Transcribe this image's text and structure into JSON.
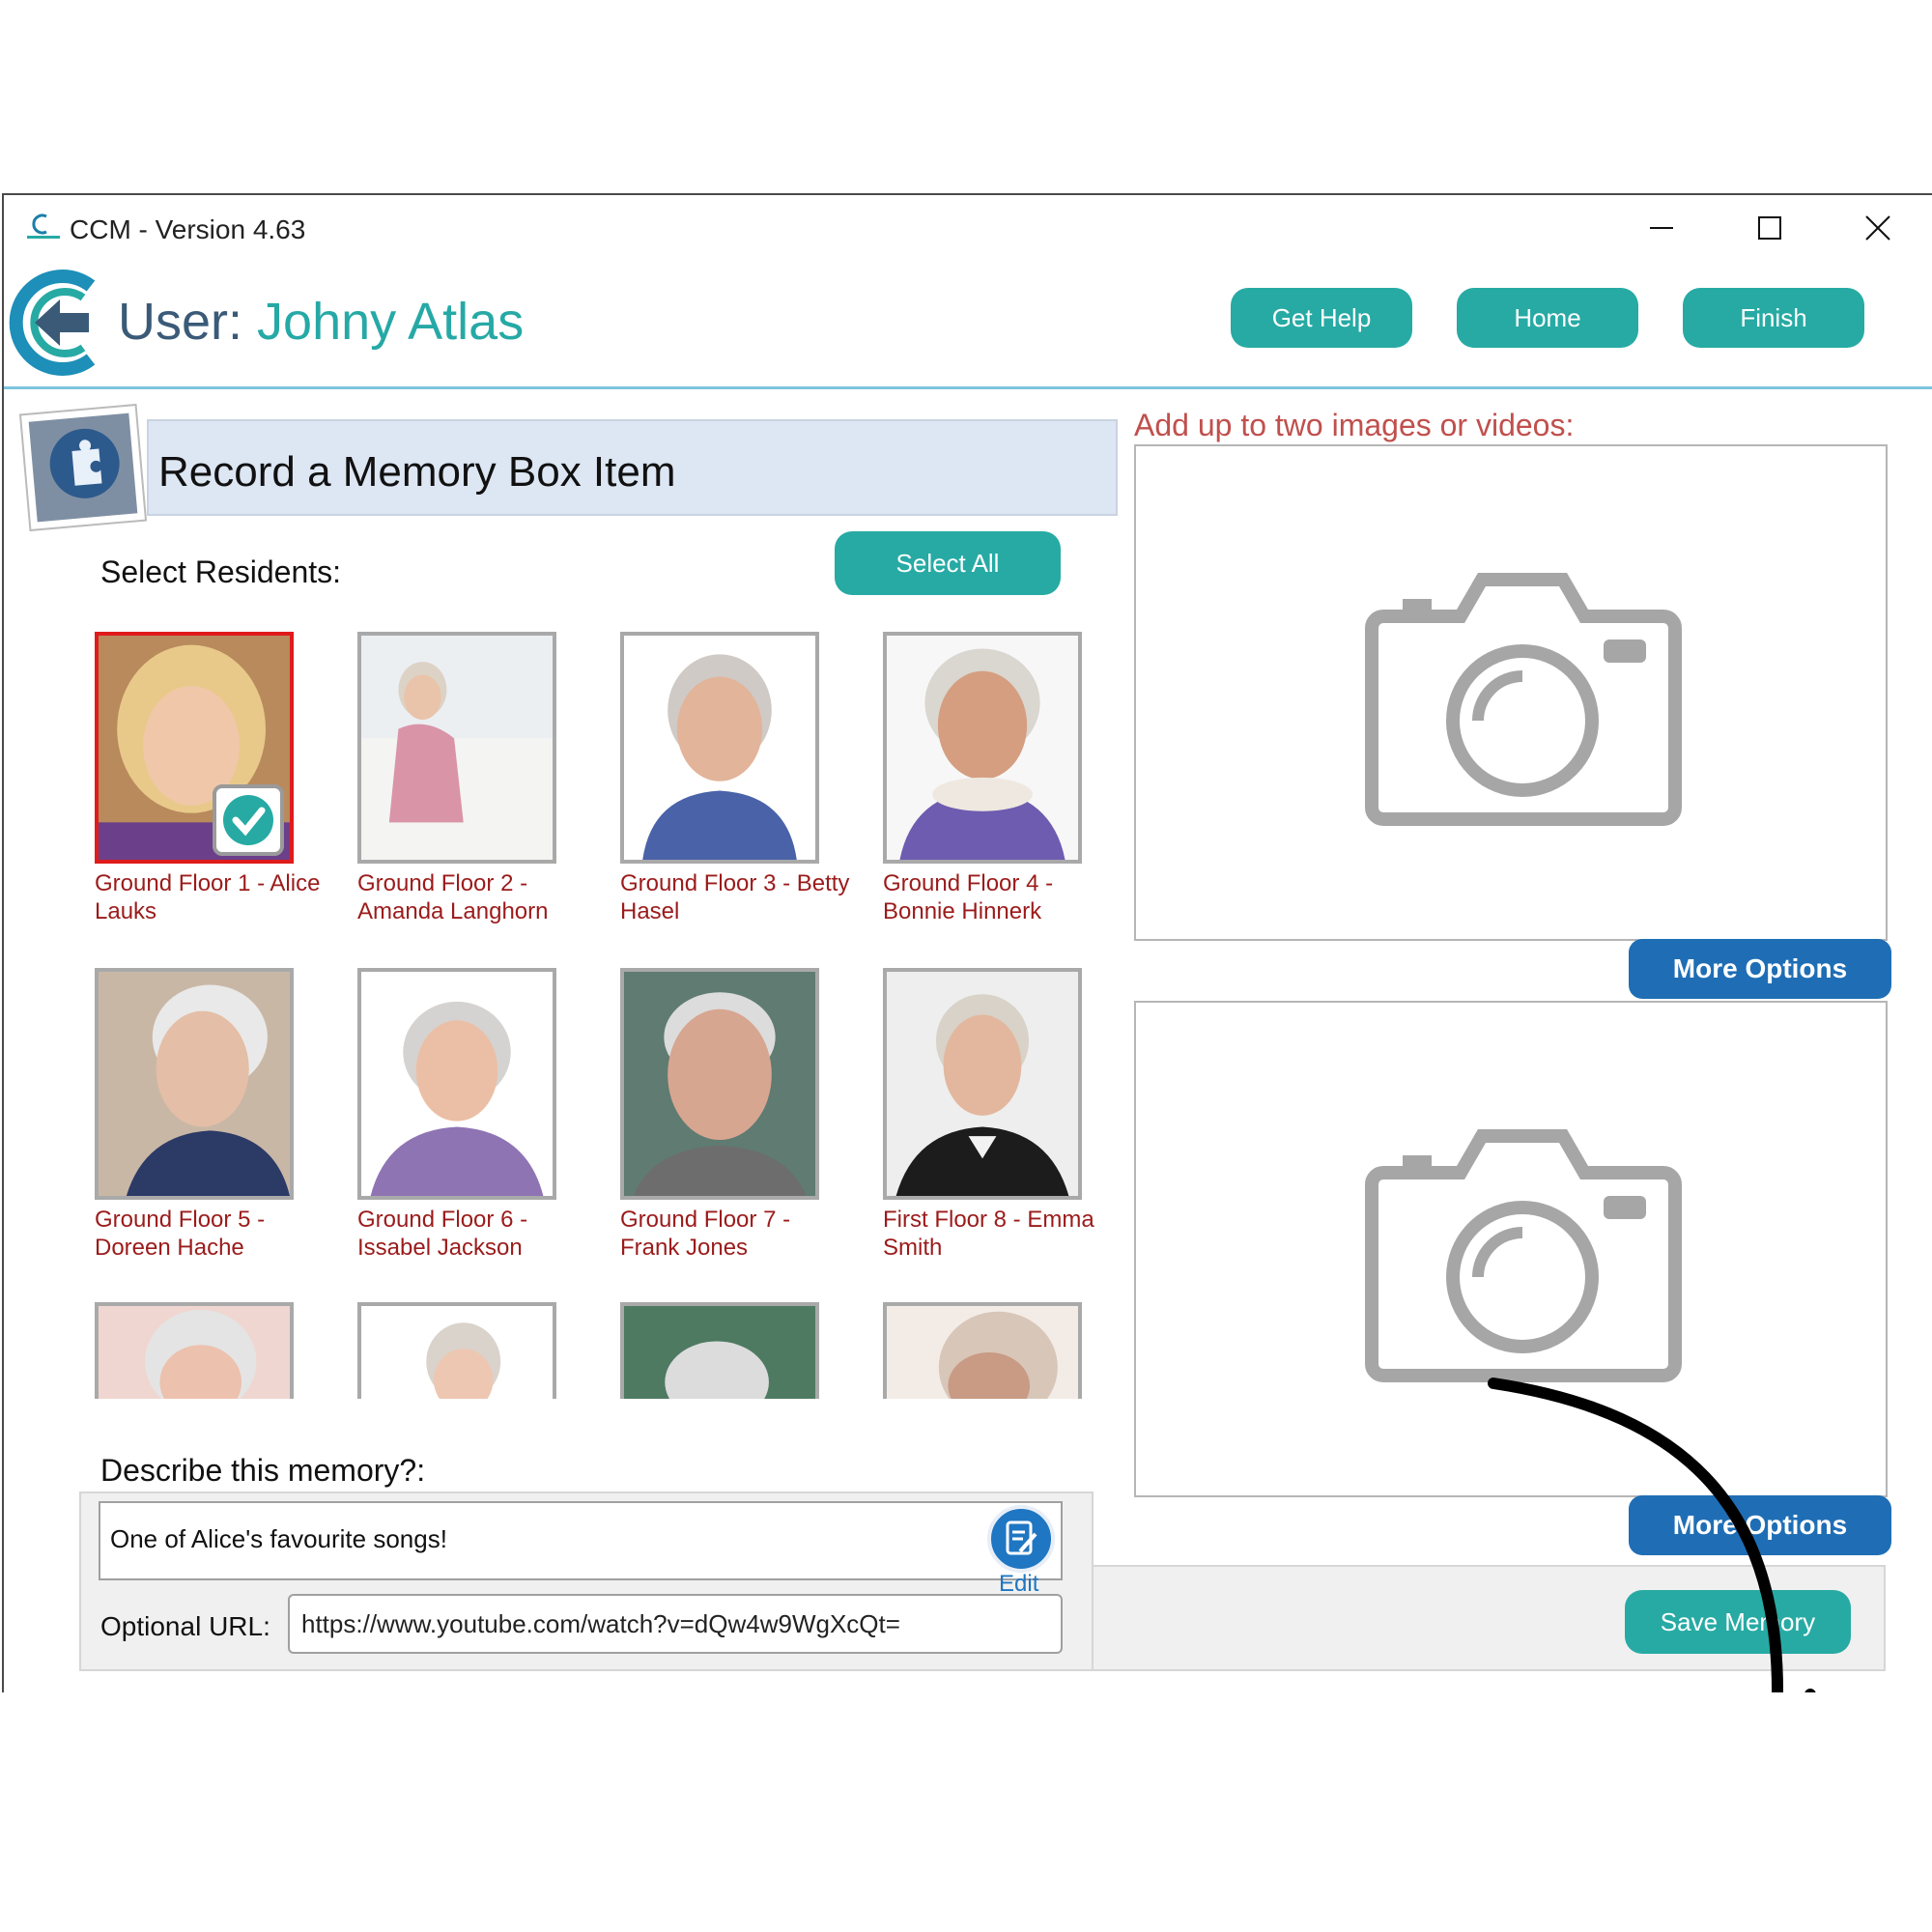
{
  "window": {
    "title": "CCM - Version 4.63"
  },
  "header": {
    "user_prefix": "User:",
    "user_name": "Johny Atlas",
    "buttons": {
      "help": "Get Help",
      "home": "Home",
      "finish": "Finish"
    }
  },
  "section": {
    "title": "Record a Memory Box Item",
    "select_label": "Select Residents:",
    "select_all": "Select All"
  },
  "residents": [
    {
      "name": "Ground Floor 1 - Alice Lauks",
      "selected": true
    },
    {
      "name": "Ground Floor 2 - Amanda Langhorn",
      "selected": false
    },
    {
      "name": "Ground Floor 3 - Betty Hasel",
      "selected": false
    },
    {
      "name": "Ground Floor 4 - Bonnie Hinnerk",
      "selected": false
    },
    {
      "name": "Ground Floor 5 - Doreen Hache",
      "selected": false
    },
    {
      "name": "Ground Floor 6 - Issabel Jackson",
      "selected": false
    },
    {
      "name": "Ground Floor 7 - Frank Jones",
      "selected": false
    },
    {
      "name": "First Floor 8 - Emma Smith",
      "selected": false
    }
  ],
  "describe": {
    "label": "Describe this memory?:",
    "value": "One of Alice's favourite songs!",
    "edit_label": "Edit",
    "url_label": "Optional URL:",
    "url_value": "https://www.youtube.com/watch?v=dQw4w9WgXcQt="
  },
  "media": {
    "label": "Add up to two images or videos:",
    "more_options_1": "More Options",
    "more_options_2": "More Options",
    "save": "Save Memory"
  },
  "colors": {
    "teal_button": "#27aaa4",
    "blue_button": "#1f6eb5",
    "resident_name": "#9b1b1b",
    "selected_border": "#e01b1b"
  }
}
